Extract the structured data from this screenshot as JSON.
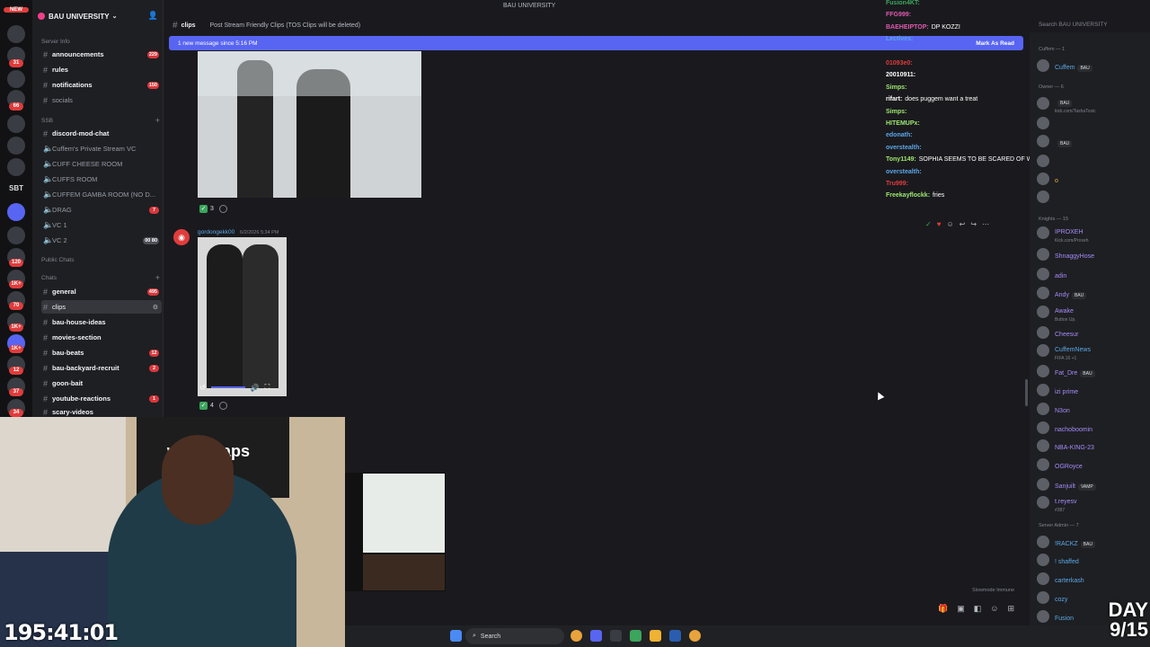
{
  "window": {
    "title": "BAU UNIVERSITY"
  },
  "server": {
    "name": "BAU UNIVERSITY"
  },
  "rail": {
    "labels": [
      "NEW",
      "SBT"
    ],
    "badges": [
      "31",
      "66",
      "120",
      "1K+",
      "70",
      "1K+",
      "1K+",
      "12",
      "37",
      "34"
    ]
  },
  "sidebar": {
    "categories": {
      "server_info": "Server Info",
      "ssb": "SSB",
      "public_chats": "Public Chats",
      "chats": "Chats"
    },
    "channels": [
      {
        "label": "announcements",
        "badge": "229"
      },
      {
        "label": "rules",
        "badge": ""
      },
      {
        "label": "notifications",
        "badge": "150"
      },
      {
        "label": "socials",
        "badge": ""
      },
      {
        "label": "discord-mod-chat",
        "badge": ""
      },
      {
        "label": "Cuffem's Private Stream VC",
        "badge": ""
      },
      {
        "label": "CUFF CHEESE ROOM",
        "badge": ""
      },
      {
        "label": "CUFFS ROOM",
        "badge": ""
      },
      {
        "label": "CUFFEM GAMBA ROOM (NO D...",
        "badge": ""
      },
      {
        "label": "DRAG",
        "badge": "7"
      },
      {
        "label": "VC 1",
        "badge": ""
      },
      {
        "label": "VC 2",
        "badge": "00 80"
      },
      {
        "label": "general",
        "badge": "495"
      },
      {
        "label": "clips",
        "badge": ""
      },
      {
        "label": "bau-house-ideas",
        "badge": ""
      },
      {
        "label": "movies-section",
        "badge": ""
      },
      {
        "label": "bau-beats",
        "badge": "12"
      },
      {
        "label": "bau-backyard-recruit",
        "badge": "2"
      },
      {
        "label": "goon-bait",
        "badge": ""
      },
      {
        "label": "youtube-reactions",
        "badge": "1"
      },
      {
        "label": "scary-videos",
        "badge": ""
      }
    ]
  },
  "topbar": {
    "channel": "clips",
    "topic": "Post Stream Friendly Clips (TOS Clips will be deleted)"
  },
  "new_message_bar": {
    "left": "1 new message since 5:16 PM",
    "right": "Mark As Read"
  },
  "messages": {
    "reaction1_count": "3",
    "author": "gordongekk00",
    "timestamp": "6/2/2026 5:34 PM",
    "reaction2_count": "4"
  },
  "stream_chat": [
    {
      "user": "Fusion4KT:",
      "text": "",
      "color": "#3ba55c"
    },
    {
      "user": "FFG999:",
      "text": "",
      "color": "#e05ab0"
    },
    {
      "user": "BAEHEIPTOP:",
      "text": "DP KOZZI",
      "color": "#e05ab0"
    },
    {
      "user": "Lectives:",
      "text": "",
      "color": "#5ba7e8"
    },
    {
      "user": "",
      "text": "",
      "color": "#fff"
    },
    {
      "user": "01093e0:",
      "text": "",
      "color": "#e03c3c"
    },
    {
      "user": "20010911:",
      "text": "",
      "color": "#fff"
    },
    {
      "user": "Simps:",
      "text": "",
      "color": "#9fe870"
    },
    {
      "user": "rifart:",
      "text": "does puggem want a treat",
      "color": "#fff"
    },
    {
      "user": "Simps:",
      "text": "",
      "color": "#9fe870"
    },
    {
      "user": "HITEMUPx:",
      "text": "",
      "color": "#9fe870"
    },
    {
      "user": "edonath:",
      "text": "",
      "color": "#5ba7e8"
    },
    {
      "user": "overstealth:",
      "text": "",
      "color": "#5ba7e8"
    },
    {
      "user": "Tony1149:",
      "text": "SOPHIA SEEMS TO BE SCARED OF WATER TYPE OF AUTISTIC BEHAVIOR",
      "color": "#9fe870"
    },
    {
      "user": "overstealth:",
      "text": "",
      "color": "#5ba7e8"
    },
    {
      "user": "Tru999:",
      "text": "",
      "color": "#e03c3c"
    },
    {
      "user": "Freekayflockk:",
      "text": "fries",
      "color": "#9fe870"
    }
  ],
  "members": {
    "search_placeholder": "Search BAU UNIVERSITY",
    "groups": {
      "cuffem": "Cuffem — 1",
      "owner": "Owner — 6",
      "knights": "Knights — 15",
      "server_admin": "Server Admin — 7"
    },
    "list": [
      {
        "name": "Cuffem",
        "sub": "",
        "tag": "BAU",
        "color": "#5ba7e8"
      },
      {
        "name": "",
        "sub": "kick.com/TashaToxic",
        "tag": "BAU",
        "color": "#e05ab0"
      },
      {
        "name": "",
        "sub": "",
        "tag": "",
        "color": "#949ba4"
      },
      {
        "name": "",
        "sub": "",
        "tag": "BAU",
        "color": "#949ba4"
      },
      {
        "name": "",
        "sub": "",
        "tag": "",
        "color": "#949ba4"
      },
      {
        "name": "o",
        "sub": "",
        "tag": "",
        "color": "#f0b232"
      },
      {
        "name": "",
        "sub": "",
        "tag": "",
        "color": "#949ba4"
      },
      {
        "name": "IPROXEH",
        "sub": "Kick.com/Proxeh",
        "tag": "",
        "color": "#a78bfa"
      },
      {
        "name": "ShnaggyHose",
        "sub": "",
        "tag": "",
        "color": "#a78bfa"
      },
      {
        "name": "adin",
        "sub": "",
        "tag": "",
        "color": "#a78bfa"
      },
      {
        "name": "Andy",
        "sub": "",
        "tag": "BAU",
        "color": "#a78bfa"
      },
      {
        "name": "Awake",
        "sub": "Button Up.",
        "tag": "",
        "color": "#a78bfa"
      },
      {
        "name": "Cheesur",
        "sub": "",
        "tag": "",
        "color": "#a78bfa"
      },
      {
        "name": "CuffemNews",
        "sub": "FIFA 16 +1",
        "tag": "",
        "color": "#5ba7e8"
      },
      {
        "name": "Fat_Dre",
        "sub": "",
        "tag": "BAU",
        "color": "#a78bfa"
      },
      {
        "name": "izi prime",
        "sub": "",
        "tag": "",
        "color": "#a78bfa"
      },
      {
        "name": "N3on",
        "sub": "",
        "tag": "",
        "color": "#a78bfa"
      },
      {
        "name": "nachoboomin",
        "sub": "",
        "tag": "",
        "color": "#a78bfa"
      },
      {
        "name": "NBA-KING-23",
        "sub": "",
        "tag": "",
        "color": "#a78bfa"
      },
      {
        "name": "OGRoyce",
        "sub": "",
        "tag": "",
        "color": "#a78bfa"
      },
      {
        "name": "Sanjuilt",
        "sub": "",
        "tag": "VAMP",
        "color": "#a78bfa"
      },
      {
        "name": "t.reyesv",
        "sub": "#387",
        "tag": "",
        "color": "#a78bfa"
      },
      {
        "name": "!RACKZ",
        "sub": "",
        "tag": "BAU",
        "color": "#5ba7e8"
      },
      {
        "name": "! shaffed",
        "sub": "",
        "tag": "",
        "color": "#5ba7e8"
      },
      {
        "name": "carterkash",
        "sub": "",
        "tag": "",
        "color": "#5ba7e8"
      },
      {
        "name": "cozy",
        "sub": "",
        "tag": "",
        "color": "#5ba7e8"
      },
      {
        "name": "Fusion",
        "sub": "",
        "tag": "",
        "color": "#5ba7e8"
      }
    ]
  },
  "slowmode": "Slowmode Immune",
  "overlay": {
    "timer": "195:41:01",
    "day_line1": "DAY",
    "day_line2": "9/15",
    "banner_text": "weedmaps"
  },
  "taskbar": {
    "search_label": "Search"
  }
}
